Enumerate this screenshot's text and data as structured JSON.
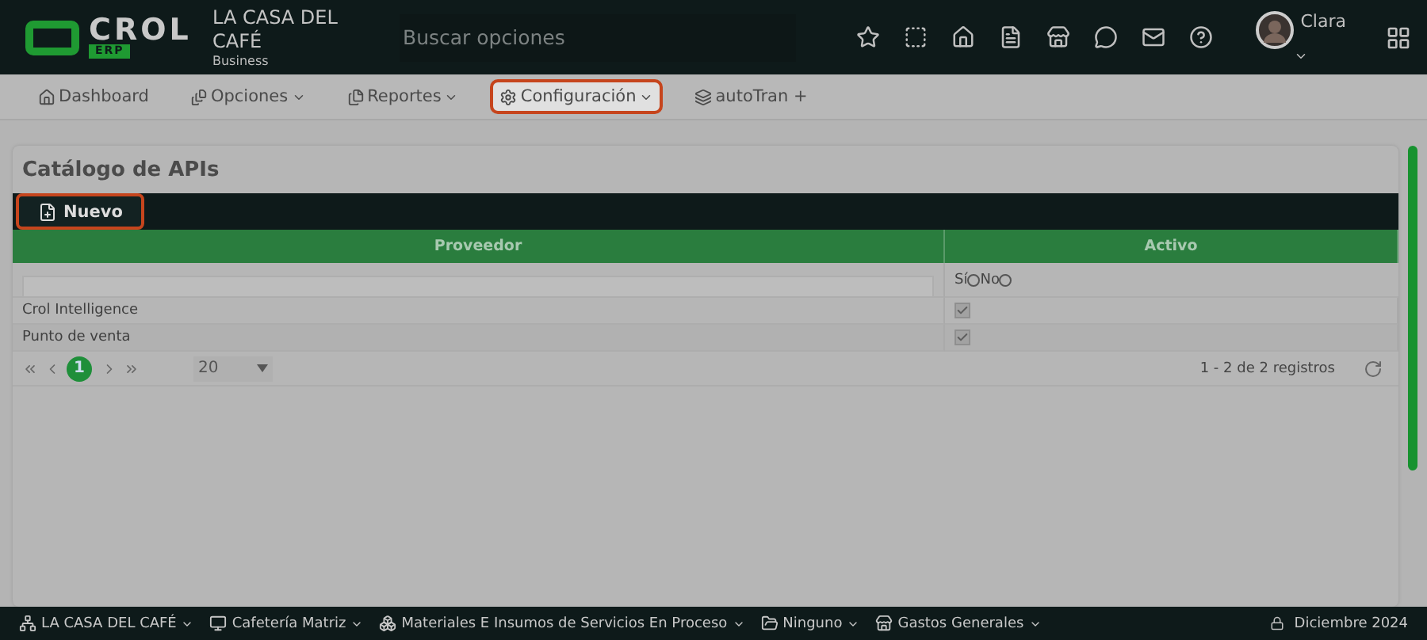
{
  "header": {
    "logo": {
      "name": "CROL",
      "sub": "ERP"
    },
    "company": "LA CASA DEL CAFÉ",
    "plan": "Business",
    "search": {
      "placeholder": "Buscar opciones"
    },
    "user": "Clara"
  },
  "nav": [
    {
      "label": "Dashboard",
      "dropdown": false,
      "highlighted": false
    },
    {
      "label": "Opciones",
      "dropdown": true,
      "highlighted": false
    },
    {
      "label": "Reportes",
      "dropdown": true,
      "highlighted": false
    },
    {
      "label": "Configuración",
      "dropdown": true,
      "highlighted": true
    },
    {
      "label": "autoTran +",
      "dropdown": false,
      "highlighted": false
    }
  ],
  "page": {
    "title": "Catálogo de APIs",
    "toolbar": {
      "button": "Nuevo",
      "highlighted": true
    },
    "table": {
      "columns": [
        "Proveedor",
        "Activo"
      ],
      "filter": {
        "options": [
          {
            "label": "Sí",
            "checked": false
          },
          {
            "label": "No",
            "checked": false
          }
        ]
      },
      "rows": [
        {
          "proveedor": "Crol Intelligence",
          "activo": true
        },
        {
          "proveedor": "Punto de venta",
          "activo": true
        }
      ]
    },
    "pager": {
      "pages": [
        {
          "label": "1",
          "selected": true
        }
      ],
      "page_size": "20",
      "summary": "1 - 2 de 2 registros"
    }
  },
  "footer": {
    "items": [
      "LA CASA DEL CAFÉ",
      "Cafetería Matriz",
      "Materiales E Insumos de Servicios En Proceso",
      "Ninguno",
      "Gastos Generales"
    ],
    "date": "Diciembre 2024"
  }
}
